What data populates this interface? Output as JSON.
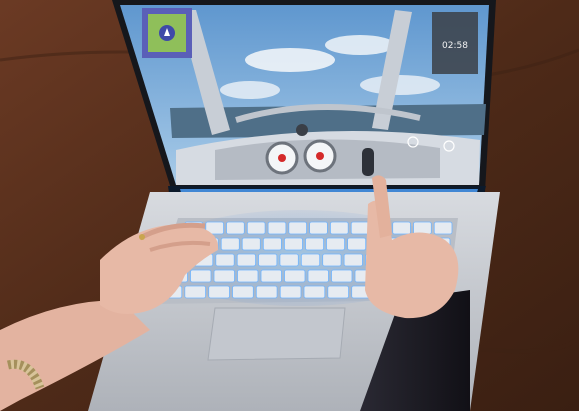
{
  "scene": {
    "caption": "",
    "colors": {
      "desk_wood": "#5a3120",
      "laptop_body": "#c9ccd1",
      "keyboard_glow": "#6fb4ff",
      "sky": "#7fb0de",
      "cockpit": "#d6dbe2",
      "skin": "#e7b9a6",
      "sleeve": "#1b1a22"
    }
  },
  "game": {
    "hud_value": "02:58",
    "hud_header": "",
    "minimap_icon": "map-icon",
    "gauges": [
      "speed-gauge",
      "altitude-gauge"
    ]
  }
}
